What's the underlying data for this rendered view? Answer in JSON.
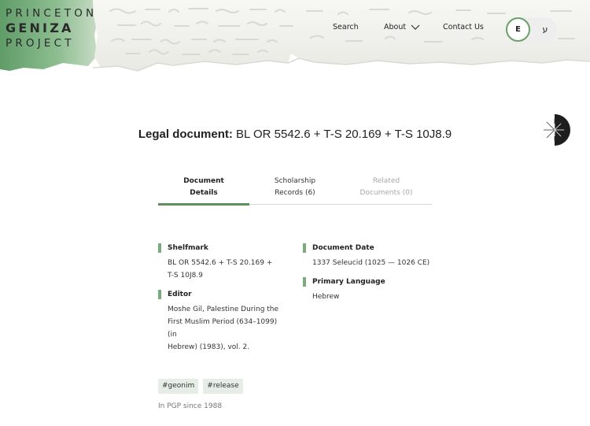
{
  "logo": {
    "line1": "PRINCETON",
    "line2": "GENIZA",
    "line3": "PROJECT"
  },
  "nav": {
    "search": "Search",
    "about": "About",
    "contact": "Contact Us"
  },
  "language": {
    "english": "E",
    "hebrew": "ע"
  },
  "document": {
    "type": "Legal document:",
    "shelfmark_title": "BL OR 5542.6 + T-S 20.169 + T-S 10J8.9"
  },
  "tabs": [
    {
      "line1": "Document",
      "line2": "Details",
      "state": "active"
    },
    {
      "line1": "Scholarship",
      "line2": "Records (6)",
      "state": "normal"
    },
    {
      "line1": "Related",
      "line2": "Documents (0)",
      "state": "disabled"
    }
  ],
  "details": {
    "shelfmark": {
      "label": "Shelfmark",
      "value_line1": "BL OR 5542.6 + T-S 20.169 +",
      "value_line2": "T-S 10J8.9"
    },
    "editor": {
      "label": "Editor",
      "value_line1": "Moshe Gil, Palestine During the",
      "value_line2": "First Muslim Period (634–1099) (in",
      "value_line3": "Hebrew) (1983), vol. 2."
    },
    "date": {
      "label": "Document Date",
      "value": "1337 Seleucid (1025 — 1026 CE)"
    },
    "language": {
      "label": "Primary Language",
      "value": "Hebrew"
    }
  },
  "tags": [
    "#geonim",
    "#release"
  ],
  "since": "In PGP since 1988",
  "colors": {
    "accent": "#5e8f5e",
    "tag_bg": "#e6ede6",
    "parchment_green": "#7fae7f"
  }
}
